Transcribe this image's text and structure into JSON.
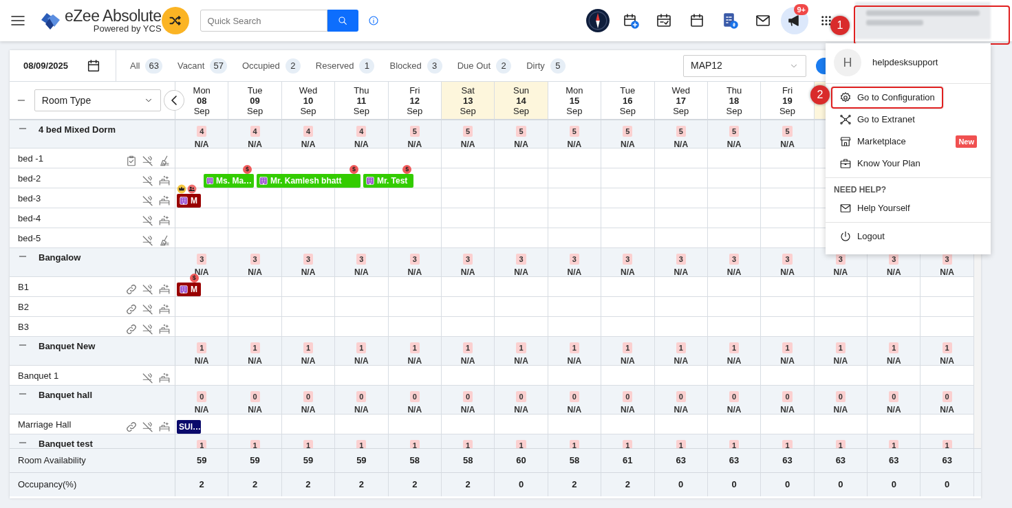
{
  "app": {
    "title": "eZee Absolute",
    "subtitle": "Powered by YCS",
    "search_placeholder": "Quick Search"
  },
  "toolbar": [
    {
      "kind": "compass"
    },
    {
      "kind": "calendar-plus"
    },
    {
      "kind": "calendar-check"
    },
    {
      "kind": "calendar"
    },
    {
      "kind": "invoice"
    },
    {
      "kind": "mail"
    },
    {
      "kind": "megaphone",
      "badge": "9+"
    },
    {
      "kind": "apps"
    }
  ],
  "annotations": [
    {
      "number": "1"
    },
    {
      "number": "2"
    }
  ],
  "filter_bar": {
    "date": "08/09/2025",
    "filters": [
      {
        "label": "All",
        "count": "63"
      },
      {
        "label": "Vacant",
        "count": "57"
      },
      {
        "label": "Occupied",
        "count": "2"
      },
      {
        "label": "Reserved",
        "count": "1"
      },
      {
        "label": "Blocked",
        "count": "3"
      },
      {
        "label": "Due Out",
        "count": "2"
      },
      {
        "label": "Dirty",
        "count": "5"
      }
    ],
    "rate_plan": "MAP12"
  },
  "grid": {
    "group_by": "Room Type",
    "days": [
      {
        "weekday": "Mon",
        "date": "08",
        "month": "Sep",
        "weekend": false
      },
      {
        "weekday": "Tue",
        "date": "09",
        "month": "Sep",
        "weekend": false
      },
      {
        "weekday": "Wed",
        "date": "10",
        "month": "Sep",
        "weekend": false
      },
      {
        "weekday": "Thu",
        "date": "11",
        "month": "Sep",
        "weekend": false
      },
      {
        "weekday": "Fri",
        "date": "12",
        "month": "Sep",
        "weekend": false
      },
      {
        "weekday": "Sat",
        "date": "13",
        "month": "Sep",
        "weekend": true
      },
      {
        "weekday": "Sun",
        "date": "14",
        "month": "Sep",
        "weekend": true
      },
      {
        "weekday": "Mon",
        "date": "15",
        "month": "Sep",
        "weekend": false
      },
      {
        "weekday": "Tue",
        "date": "16",
        "month": "Sep",
        "weekend": false
      },
      {
        "weekday": "Wed",
        "date": "17",
        "month": "Sep",
        "weekend": false
      },
      {
        "weekday": "Thu",
        "date": "18",
        "month": "Sep",
        "weekend": false
      },
      {
        "weekday": "Fri",
        "date": "19",
        "month": "Sep",
        "weekend": false
      },
      {
        "weekend": true
      }
    ],
    "rows": [
      {
        "kind": "group",
        "name": "4 bed Mixed Dorm",
        "expanded": true,
        "counts": [
          "4",
          "4",
          "4",
          "4",
          "5",
          "5",
          "5",
          "5",
          "5",
          "5",
          "5",
          "5"
        ],
        "rates": [
          "N/A",
          "N/A",
          "N/A",
          "N/A",
          "N/A",
          "N/A",
          "N/A",
          "N/A",
          "N/A",
          "N/A",
          "N/A",
          "N/A"
        ]
      },
      {
        "kind": "room",
        "name": "bed -1",
        "inspected": true,
        "linked": false,
        "non_smoking": true,
        "dirty": true,
        "bookings": []
      },
      {
        "kind": "room",
        "name": "bed-2",
        "inspected": false,
        "linked": false,
        "non_smoking": true,
        "dirty": false,
        "bookings": [
          {
            "guest": "Ms. Ma…",
            "color": "#33cc00",
            "channel": true,
            "badges": [
              {
                "kind": "payment",
                "text": "$"
              }
            ]
          },
          {
            "guest": "Mr. Kamlesh bhatt",
            "color": "#33cc00",
            "channel": true,
            "badges": [
              {
                "kind": "payment",
                "text": "$"
              }
            ]
          },
          {
            "guest": "Mr. Test",
            "color": "#33cc00",
            "channel": true,
            "badges": [
              {
                "kind": "payment",
                "text": "$"
              }
            ]
          }
        ]
      },
      {
        "kind": "room",
        "name": "bed-3",
        "inspected": false,
        "linked": false,
        "non_smoking": true,
        "dirty": false,
        "bookings": [
          {
            "guest": "M",
            "color": "#990000",
            "channel": true,
            "badges": [
              {
                "kind": "vip"
              },
              {
                "kind": "group"
              }
            ]
          }
        ]
      },
      {
        "kind": "room",
        "name": "bed-4",
        "inspected": false,
        "linked": false,
        "non_smoking": true,
        "dirty": false,
        "bookings": []
      },
      {
        "kind": "room",
        "name": "bed-5",
        "inspected": false,
        "linked": false,
        "non_smoking": true,
        "dirty": true,
        "bookings": []
      },
      {
        "kind": "group",
        "name": "Bangalow",
        "expanded": true,
        "counts": [
          "3",
          "3",
          "3",
          "3",
          "3",
          "3",
          "3",
          "3",
          "3",
          "3",
          "3",
          "3",
          "3",
          "3",
          "3"
        ],
        "rates": [
          "N/A",
          "N/A",
          "N/A",
          "N/A",
          "N/A",
          "N/A",
          "N/A",
          "N/A",
          "N/A",
          "N/A",
          "N/A",
          "N/A",
          "N/A",
          "N/A",
          "N/A"
        ]
      },
      {
        "kind": "room",
        "name": "B1",
        "inspected": false,
        "linked": true,
        "non_smoking": true,
        "dirty": false,
        "bookings": [
          {
            "guest": "M",
            "color": "#990000",
            "channel": true,
            "badges": [
              {
                "kind": "payment",
                "text": "$"
              }
            ]
          }
        ]
      },
      {
        "kind": "room",
        "name": "B2",
        "inspected": false,
        "linked": true,
        "non_smoking": true,
        "dirty": false,
        "bookings": []
      },
      {
        "kind": "room",
        "name": "B3",
        "inspected": false,
        "linked": true,
        "non_smoking": true,
        "dirty": false,
        "bookings": []
      },
      {
        "kind": "group",
        "name": "Banquet New",
        "expanded": true,
        "counts": [
          "1",
          "1",
          "1",
          "1",
          "1",
          "1",
          "1",
          "1",
          "1",
          "1",
          "1",
          "1",
          "1",
          "1",
          "1"
        ],
        "rates": [
          "N/A",
          "N/A",
          "N/A",
          "N/A",
          "N/A",
          "N/A",
          "N/A",
          "N/A",
          "N/A",
          "N/A",
          "N/A",
          "N/A",
          "N/A",
          "N/A",
          "N/A"
        ]
      },
      {
        "kind": "room",
        "name": "Banquet 1",
        "inspected": false,
        "linked": false,
        "non_smoking": true,
        "dirty": false,
        "bookings": []
      },
      {
        "kind": "group",
        "name": "Banquet hall",
        "expanded": true,
        "counts": [
          "0",
          "0",
          "0",
          "0",
          "0",
          "0",
          "0",
          "0",
          "0",
          "0",
          "0",
          "0",
          "0",
          "0",
          "0"
        ],
        "rates": [
          "N/A",
          "N/A",
          "N/A",
          "N/A",
          "N/A",
          "N/A",
          "N/A",
          "N/A",
          "N/A",
          "N/A",
          "N/A",
          "N/A",
          "N/A",
          "N/A",
          "N/A"
        ]
      },
      {
        "kind": "room",
        "name": "Marriage Hall",
        "inspected": false,
        "linked": true,
        "non_smoking": true,
        "dirty": false,
        "bookings": [
          {
            "guest": "SUI…",
            "color": "#0a0a6b",
            "channel": false
          }
        ]
      },
      {
        "kind": "group",
        "name": "Banquet test",
        "expanded": true,
        "counts": [
          "1",
          "1",
          "1",
          "1",
          "1",
          "1",
          "1",
          "1",
          "1",
          "1",
          "1",
          "1",
          "1",
          "1",
          "1"
        ],
        "rates": []
      }
    ],
    "footer": [
      {
        "label": "Room Availability",
        "values": [
          "59",
          "59",
          "59",
          "59",
          "58",
          "58",
          "60",
          "58",
          "61",
          "63",
          "63",
          "63",
          "63",
          "63",
          "63"
        ]
      },
      {
        "label": "Occupancy(%)",
        "values": [
          "2",
          "2",
          "2",
          "2",
          "2",
          "2",
          "0",
          "2",
          "2",
          "0",
          "0",
          "0",
          "0",
          "0",
          "0"
        ]
      }
    ]
  },
  "user_menu": {
    "avatar": "H",
    "username": "helpdesksupport",
    "items": [
      {
        "kind": "gear",
        "label": "Go to Configuration",
        "highlighted": true
      },
      {
        "kind": "network",
        "label": "Go to Extranet",
        "highlighted": false
      },
      {
        "kind": "store",
        "label": "Marketplace",
        "highlighted": false,
        "tag": "New"
      },
      {
        "kind": "briefcase",
        "label": "Know Your Plan",
        "highlighted": false
      }
    ],
    "help_heading": "NEED HELP?",
    "help_items": [
      {
        "kind": "mail",
        "label": "Help Yourself",
        "highlighted": false
      }
    ],
    "logout": {
      "kind": "power",
      "label": "Logout",
      "highlighted": false
    }
  }
}
